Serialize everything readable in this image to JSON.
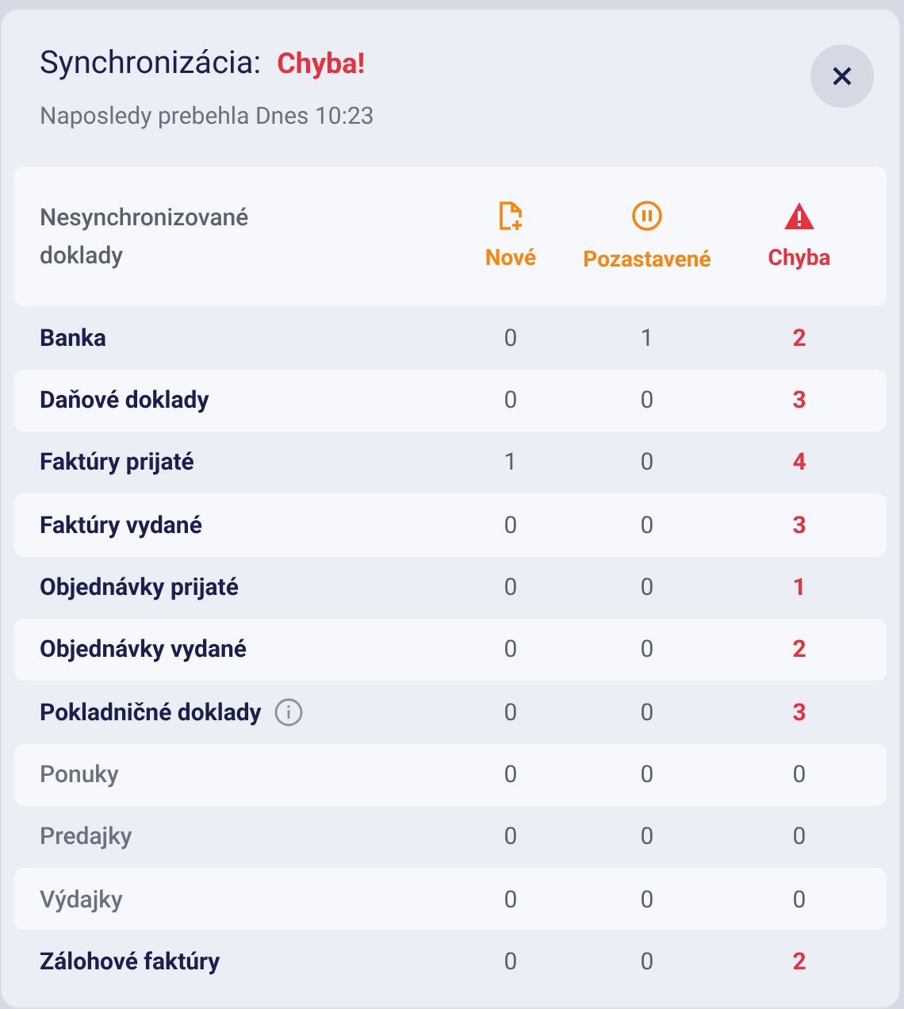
{
  "title": "Synchronizácia:",
  "status": "Chyba!",
  "subtitle": "Naposledy prebehla Dnes 10:23",
  "table": {
    "label": "Nesynchronizované doklady",
    "columns": [
      {
        "kind": "new",
        "label": "Nové"
      },
      {
        "kind": "paused",
        "label": "Pozastavené"
      },
      {
        "kind": "error",
        "label": "Chyba"
      }
    ],
    "rows": [
      {
        "name": "Banka",
        "muted": false,
        "info": false,
        "values": [
          "0",
          "1",
          "2"
        ]
      },
      {
        "name": "Daňové doklady",
        "muted": false,
        "info": false,
        "values": [
          "0",
          "0",
          "3"
        ]
      },
      {
        "name": "Faktúry prijaté",
        "muted": false,
        "info": false,
        "values": [
          "1",
          "0",
          "4"
        ]
      },
      {
        "name": "Faktúry vydané",
        "muted": false,
        "info": false,
        "values": [
          "0",
          "0",
          "3"
        ]
      },
      {
        "name": "Objednávky prijaté",
        "muted": false,
        "info": false,
        "values": [
          "0",
          "0",
          "1"
        ]
      },
      {
        "name": "Objednávky vydané",
        "muted": false,
        "info": false,
        "values": [
          "0",
          "0",
          "2"
        ]
      },
      {
        "name": "Pokladničné doklady",
        "muted": false,
        "info": true,
        "values": [
          "0",
          "0",
          "3"
        ]
      },
      {
        "name": "Ponuky",
        "muted": true,
        "info": false,
        "values": [
          "0",
          "0",
          "0"
        ]
      },
      {
        "name": "Predajky",
        "muted": true,
        "info": false,
        "values": [
          "0",
          "0",
          "0"
        ]
      },
      {
        "name": "Výdajky",
        "muted": true,
        "info": false,
        "values": [
          "0",
          "0",
          "0"
        ]
      },
      {
        "name": "Zálohové faktúry",
        "muted": false,
        "info": false,
        "values": [
          "0",
          "0",
          "2"
        ]
      }
    ]
  }
}
